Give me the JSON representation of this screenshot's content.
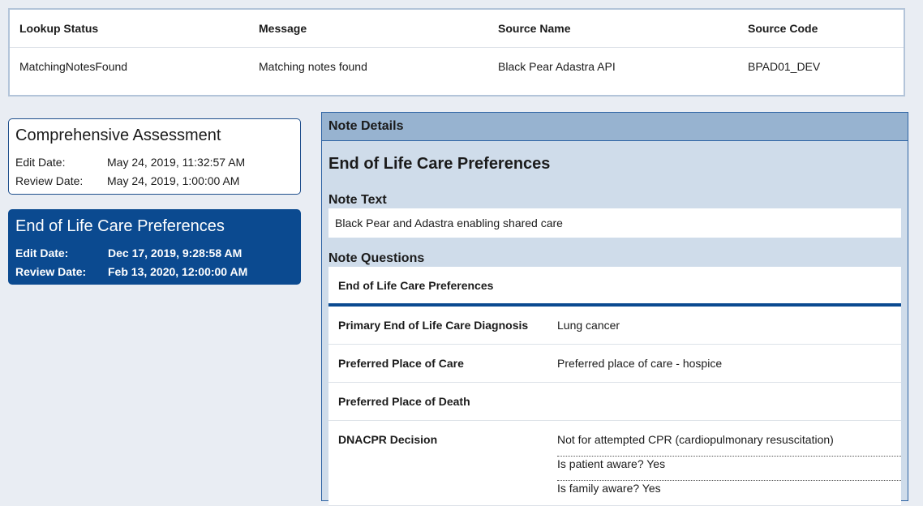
{
  "lookup": {
    "headers": [
      "Lookup Status",
      "Message",
      "Source Name",
      "Source Code"
    ],
    "values": [
      "MatchingNotesFound",
      "Matching notes found",
      "Black Pear Adastra API",
      "BPAD01_DEV"
    ]
  },
  "notes": [
    {
      "title": "Comprehensive Assessment",
      "edit_label": "Edit Date:",
      "edit_date": "May 24, 2019, 11:32:57 AM",
      "review_label": "Review Date:",
      "review_date": "May 24, 2019, 1:00:00 AM"
    },
    {
      "title": "End of Life Care Preferences",
      "edit_label": "Edit Date:",
      "edit_date": "Dec 17, 2019, 9:28:58 AM",
      "review_label": "Review Date:",
      "review_date": "Feb 13, 2020, 12:00:00 AM"
    }
  ],
  "details": {
    "header": "Note Details",
    "title": "End of Life Care Preferences",
    "note_text_label": "Note Text",
    "note_text": "Black Pear and Adastra enabling shared care",
    "questions_label": "Note Questions",
    "questions_header": "End of Life Care Preferences",
    "questions": [
      {
        "q": "Primary End of Life Care Diagnosis",
        "a": "Lung cancer"
      },
      {
        "q": "Preferred Place of Care",
        "a": "Preferred place of care - hospice"
      },
      {
        "q": "Preferred Place of Death",
        "a": ""
      },
      {
        "q": "DNACPR Decision",
        "answers": [
          "Not for attempted CPR (cardiopulmonary resuscitation)",
          "Is patient aware? Yes",
          "Is family aware? Yes"
        ]
      }
    ]
  },
  "colors": {
    "accent": "#0b4a90",
    "panel_bg": "#cfdcea",
    "panel_header": "#97b3d0"
  }
}
